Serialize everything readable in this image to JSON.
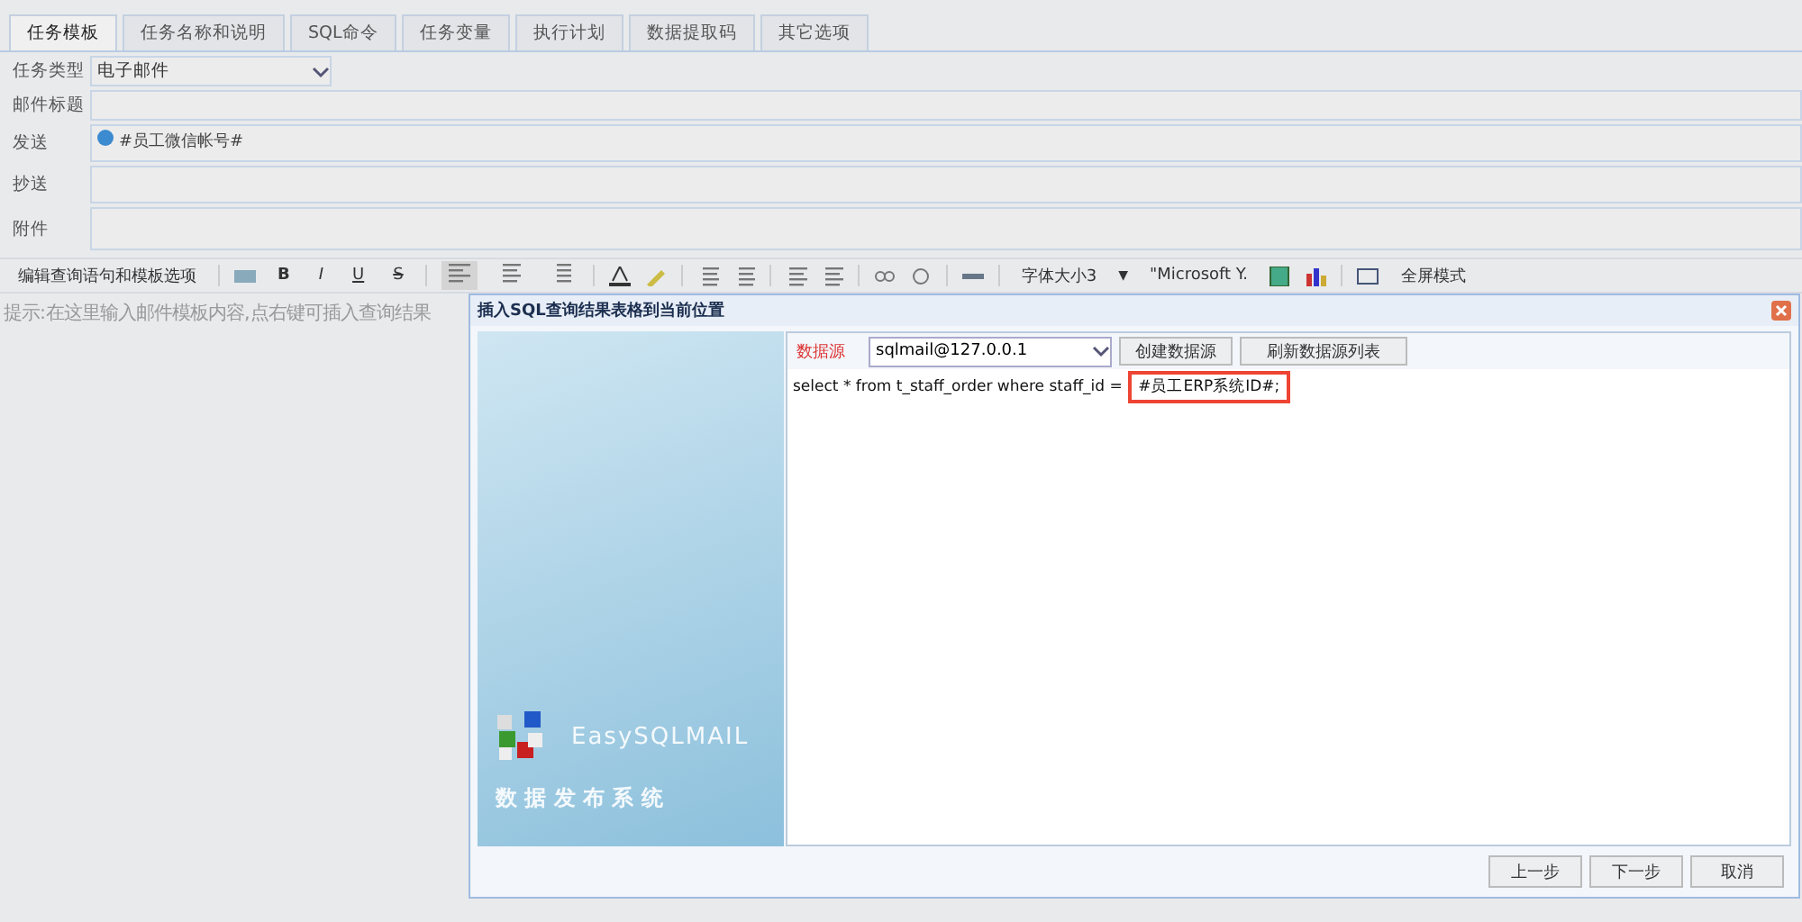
{
  "tabs": [
    {
      "label": "任务模板",
      "selected": true
    },
    {
      "label": "任务名称和说明",
      "selected": false
    },
    {
      "label": "SQL命令",
      "selected": false
    },
    {
      "label": "任务变量",
      "selected": false
    },
    {
      "label": "执行计划",
      "selected": false
    },
    {
      "label": "数据提取码",
      "selected": false
    },
    {
      "label": "其它选项",
      "selected": false
    }
  ],
  "form": {
    "type_label": "任务类型",
    "type_value": "电子邮件",
    "subject_label": "邮件标题",
    "to_label": "发送",
    "to_value": "#员工微信帐号#",
    "cc_label": "抄送",
    "attach_label": "附件"
  },
  "toolbar": {
    "edit_label": "编辑查询语句和模板选项",
    "format_buttons": [
      {
        "label": "B",
        "selected": false
      },
      {
        "label": "I",
        "selected": false
      },
      {
        "label": "U",
        "selected": false
      },
      {
        "label": "S",
        "selected": false
      }
    ],
    "align": [
      {
        "selected": true
      },
      {
        "selected": false
      },
      {
        "selected": false
      }
    ],
    "font_size": "字体大小3",
    "font_size_caret": "▼",
    "font_name": "\"Microsoft Y.",
    "fullscreen": "全屏模式"
  },
  "editor": {
    "placeholder": "提示:在这里输入邮件模板内容,点右键可插入查询结果"
  },
  "dialog": {
    "title": "插入SQL查询结果表格到当前位置",
    "brand": "EasySQLMAIL",
    "slogan": "数 据 发 布 系 统",
    "datasource_label": "数据源",
    "datasource_value": "sqlmail@127.0.0.1",
    "create_button": "创建数据源",
    "refresh_button": "刷新数据源列表",
    "sql_text": "select * from t_staff_order where staff_id = ",
    "sql_highlight": "#员工ERP系统ID#;",
    "buttons": [
      "上一步",
      "下一步",
      "取消"
    ]
  }
}
